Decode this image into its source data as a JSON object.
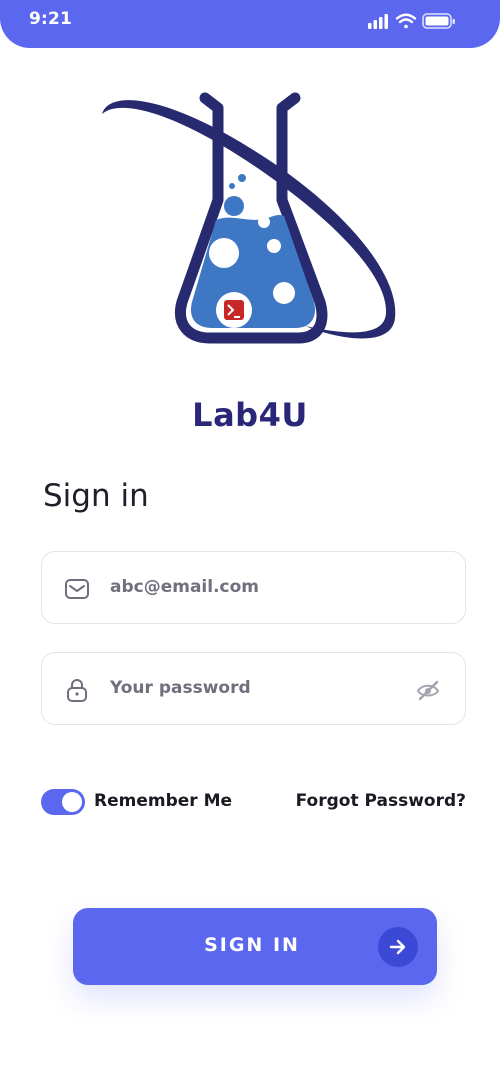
{
  "status_bar": {
    "time": "9:21"
  },
  "app": {
    "name": "Lab4U"
  },
  "form": {
    "title": "Sign in",
    "email_value": "abc@email.com",
    "password_placeholder": "Your password",
    "remember_label": "Remember Me",
    "remember_enabled": true,
    "forgot_label": "Forgot Password?",
    "submit_label": "SIGN IN"
  },
  "colors": {
    "accent": "#5a67ee",
    "brand_text": "#2a2778",
    "flask_liquid": "#3e78c4",
    "terminal_badge": "#c62828"
  },
  "icons": {
    "email": "mail-icon",
    "password": "lock-icon",
    "visibility": "eye-off-icon",
    "submit": "arrow-right-icon"
  }
}
